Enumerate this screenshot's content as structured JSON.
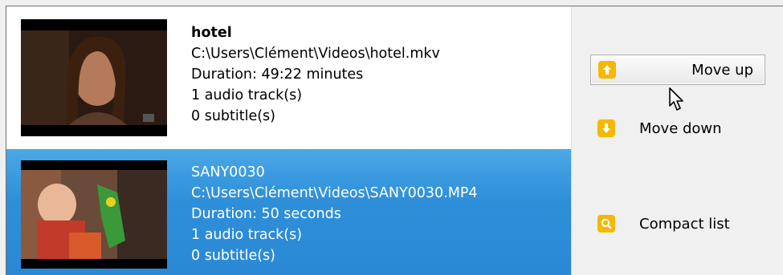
{
  "videos": [
    {
      "title": "hotel",
      "path": "C:\\Users\\Clément\\Videos\\hotel.mkv",
      "duration": "Duration: 49:22 minutes",
      "audio": "1 audio track(s)",
      "subtitles": "0 subtitle(s)",
      "selected": false
    },
    {
      "title": "SANY0030",
      "path": "C:\\Users\\Clément\\Videos\\SANY0030.MP4",
      "duration": "Duration: 50 seconds",
      "audio": "1 audio track(s)",
      "subtitles": "0 subtitle(s)",
      "selected": true
    }
  ],
  "buttons": {
    "move_up": "Move up",
    "move_down": "Move down",
    "compact_list": "Compact list"
  },
  "icons": {
    "move_up": "arrow-up-icon",
    "move_down": "arrow-down-icon",
    "compact_list": "compact-list-icon",
    "cursor": "mouse-pointer-icon"
  },
  "colors": {
    "selection": "#2f8fd9",
    "icon_bg": "#f5b800"
  }
}
